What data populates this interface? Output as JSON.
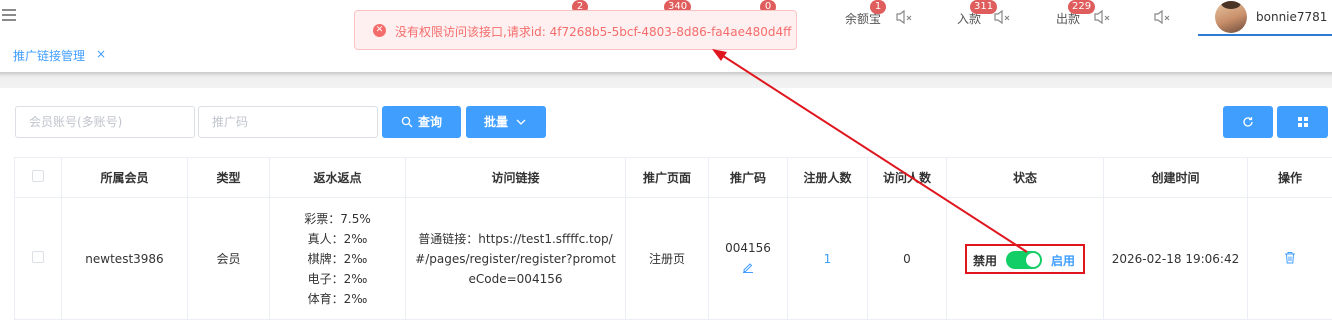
{
  "header": {
    "badges": {
      "b1": "2",
      "b2": "340",
      "b3": "0"
    },
    "yuebao": {
      "label": "余额宝",
      "badge": "1"
    },
    "deposit": {
      "label": "入款",
      "badge": "311"
    },
    "withdraw": {
      "label": "出款",
      "badge": "229"
    },
    "username": "bonnie7781"
  },
  "tabs": [
    {
      "label": "推广链接管理",
      "close": "×"
    }
  ],
  "toast": {
    "message": "没有权限访问该接口,请求id: 4f7268b5-5bcf-4803-8d86-fa4ae480d4ff"
  },
  "filters": {
    "member_placeholder": "会员账号(多账号)",
    "code_placeholder": "推广码",
    "search_label": "查询",
    "batch_label": "批量"
  },
  "table": {
    "headers": [
      "所属会员",
      "类型",
      "返水返点",
      "访问链接",
      "推广页面",
      "推广码",
      "注册人数",
      "访问人数",
      "状态",
      "创建时间",
      "操作"
    ],
    "rows": [
      {
        "member": "newtest3986",
        "type": "会员",
        "rebate": [
          "彩票：7.5%",
          "真人：2‰",
          "棋牌：2‰",
          "电子：2‰",
          "体育：2‰"
        ],
        "link": "普通链接：https://test1.sffffc.top/#/pages/register/register?promoteCode=004156",
        "page": "注册页",
        "code": "004156",
        "registered": "1",
        "visits": "0",
        "status_off": "禁用",
        "status_on": "启用",
        "created": "2026-02-18 19:06:42"
      }
    ]
  },
  "colors": {
    "primary": "#409eff",
    "danger": "#f56c6c",
    "switch_on": "#13ce66",
    "highlight": "#e0161e"
  }
}
